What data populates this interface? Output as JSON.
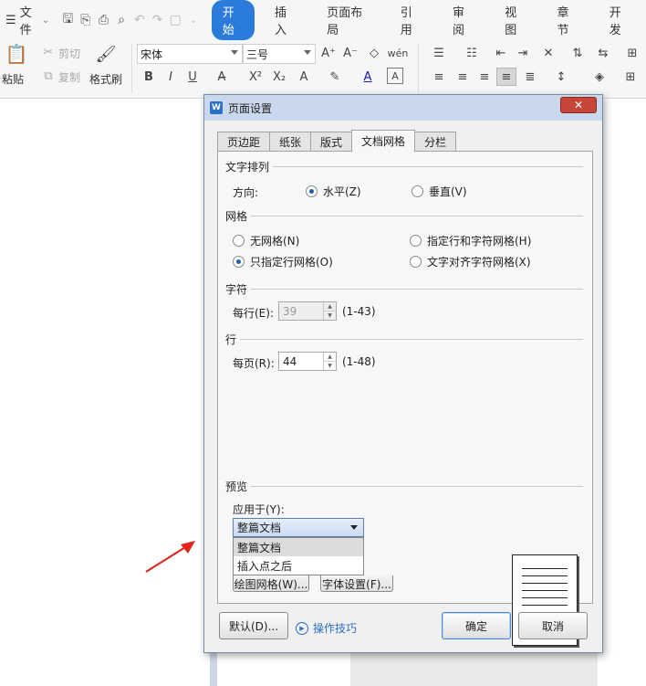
{
  "ribbon": {
    "file_label": "文件",
    "tabs": [
      "开始",
      "插入",
      "页面布局",
      "引用",
      "审阅",
      "视图",
      "章节",
      "开发"
    ],
    "active_tab": "开始",
    "paste_label": "粘贴",
    "cut_label": "剪切",
    "copy_label": "复制",
    "format_painter_label": "格式刷",
    "font_name": "宋体",
    "font_size": "三号"
  },
  "dialog": {
    "title": "页面设置",
    "close_symbol": "✕",
    "tabs": [
      "页边距",
      "纸张",
      "版式",
      "文档网格",
      "分栏"
    ],
    "active_tab": "文档网格",
    "text_direction": {
      "section": "文字排列",
      "direction_label": "方向:",
      "horizontal": "水平(Z)",
      "vertical": "垂直(V)",
      "selected": "horizontal"
    },
    "grid": {
      "section": "网格",
      "options": [
        "无网格(N)",
        "指定行和字符网格(H)",
        "只指定行网格(O)",
        "文字对齐字符网格(X)"
      ],
      "selected": "只指定行网格(O)"
    },
    "chars": {
      "section": "字符",
      "per_line_label": "每行(E):",
      "per_line_value": "39",
      "range": "(1-43)"
    },
    "lines": {
      "section": "行",
      "per_page_label": "每页(R):",
      "per_page_value": "44",
      "range": "(1-48)"
    },
    "preview": {
      "section": "预览",
      "apply_to_label": "应用于(Y):",
      "apply_to_value": "整篇文档",
      "apply_to_options": [
        "整篇文档",
        "插入点之后"
      ]
    },
    "buttons": {
      "draw_grid": "绘图网格(W)...",
      "font_settings": "字体设置(F)...",
      "default": "默认(D)...",
      "tips": "操作技巧",
      "ok": "确定",
      "cancel": "取消"
    }
  }
}
